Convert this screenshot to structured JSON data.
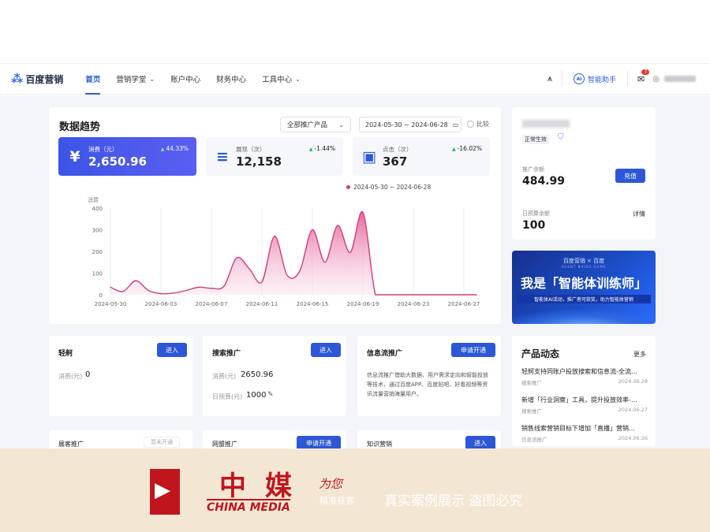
{
  "nav": {
    "logo": "百度营销",
    "items": [
      {
        "label": "首页",
        "active": true,
        "dropdown": false
      },
      {
        "label": "营销学堂",
        "active": false,
        "dropdown": true
      },
      {
        "label": "账户中心",
        "active": false,
        "dropdown": false
      },
      {
        "label": "财务中心",
        "active": false,
        "dropdown": false
      },
      {
        "label": "工具中心",
        "active": false,
        "dropdown": true
      }
    ],
    "assistant": "智能助手",
    "message_badge": "7"
  },
  "trend": {
    "title": "数据趋势",
    "product_select": "全部推广产品",
    "date_range": "2024-05-30 ~ 2024-06-28",
    "compare_label": "比较",
    "metrics": [
      {
        "icon": "¥",
        "label": "消费（元）",
        "value": "2,650.96",
        "change": "44.33%",
        "selected": true
      },
      {
        "icon": "≡",
        "label": "展现（次）",
        "value": "12,158",
        "change": "-1.44%",
        "selected": false
      },
      {
        "icon": "▣",
        "label": "点击（次）",
        "value": "367",
        "change": "-16.02%",
        "selected": false
      }
    ],
    "legend": "2024-05-30 ~ 2024-06-28"
  },
  "chart_data": {
    "type": "area",
    "title": "",
    "xlabel": "",
    "ylabel": "消费",
    "ylim": [
      0,
      400
    ],
    "yticks": [
      "400",
      "300",
      "200",
      "100",
      "0"
    ],
    "xticks": [
      "2024-05-30",
      "2024-06-03",
      "2024-06-07",
      "2024-06-11",
      "2024-06-15",
      "2024-06-19",
      "2024-06-23",
      "2024-06-27"
    ],
    "x": [
      0,
      1,
      2,
      3,
      4,
      5,
      6,
      7,
      8,
      9,
      10,
      11,
      12,
      13,
      14,
      15,
      16,
      17,
      18,
      19,
      20,
      21,
      22,
      23,
      24,
      25,
      26,
      27,
      28,
      29
    ],
    "series": [
      {
        "name": "2024-05-30 ~ 2024-06-28",
        "color": "#d63b7a",
        "values": [
          35,
          15,
          65,
          20,
          5,
          8,
          20,
          35,
          30,
          40,
          170,
          120,
          60,
          270,
          90,
          110,
          300,
          150,
          320,
          195,
          380,
          0,
          0,
          0,
          0,
          0,
          0,
          0,
          0,
          0
        ]
      }
    ],
    "grid": "vertical"
  },
  "account": {
    "status_tag": "正常生效",
    "balance_label": "推广余额",
    "balance_value": "484.99",
    "recharge_button": "充值",
    "budget_label": "日预算余额",
    "budget_value": "100",
    "detail_link": "详情"
  },
  "banner": {
    "brand": "百度营销 × 百度",
    "brand_sub": "AGENT BAIDU GAME",
    "headline": "我是「智能体训练师」",
    "subline": "智能体AI活动，推广者可获奖，助力智能体营销"
  },
  "products": {
    "light": {
      "title": "轻舸",
      "button": "进入",
      "spend_label": "消费(元)",
      "spend_value": "0"
    },
    "search": {
      "title": "搜索推广",
      "button": "进入",
      "spend_label": "消费(元)",
      "spend_value": "2650.96",
      "budget_label": "日预算(元)",
      "budget_value": "1000"
    },
    "feed": {
      "title": "信息流推广",
      "button": "申请开通",
      "desc": "信息流推广借助大数据、用户需求定向和智能投放等技术，通过百度APP、百度贴吧、好看视频等资讯流量营销海量用户。"
    }
  },
  "news": {
    "title": "产品动态",
    "more": "更多",
    "items": [
      {
        "title": "轻舸支持同账户投放搜索和信息流-全流…",
        "tag": "搜索推广",
        "date": "2024.06.28"
      },
      {
        "title": "新增「行业洞察」工具，提升投放效率-…",
        "tag": "搜索推广",
        "date": "2024.06.27"
      },
      {
        "title": "销售线索营销目标下增加「直播」营销…",
        "tag": "信息流推广",
        "date": "2024.06.26"
      }
    ]
  },
  "row3": {
    "card1_title": "展客推广",
    "card1_ghost": "暂未开通",
    "card2_title": "网盟推广",
    "card2_button": "申请开通",
    "card3_title": "知识营销",
    "card3_button": "进入"
  },
  "watermark": {
    "cn": "中媒",
    "wei": "为您",
    "en": "CHINA MEDIA",
    "tag": "精准获客",
    "claim": "真实案例展示 盗图必究"
  }
}
